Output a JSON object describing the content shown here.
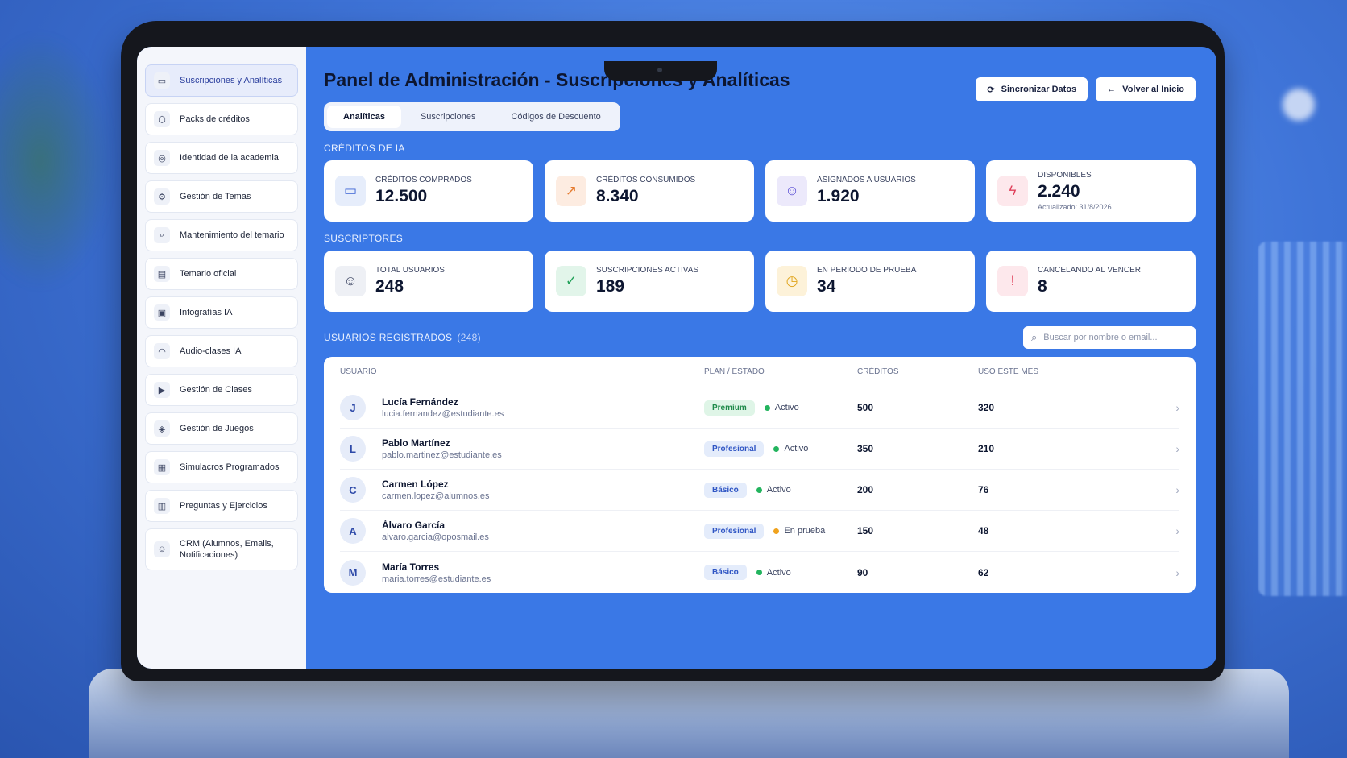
{
  "sidebar": {
    "items": [
      {
        "label": "Suscripciones y Analíticas",
        "icon": "credit-card-icon",
        "glyph": "▭",
        "active": true
      },
      {
        "label": "Packs de créditos",
        "icon": "box-icon",
        "glyph": "⬡"
      },
      {
        "label": "Identidad de la academia",
        "icon": "palette-icon",
        "glyph": "◎"
      },
      {
        "label": "Gestión de Temas",
        "icon": "gear-icon",
        "glyph": "⚙"
      },
      {
        "label": "Mantenimiento del temario",
        "icon": "search-icon",
        "glyph": "⌕"
      },
      {
        "label": "Temario oficial",
        "icon": "document-icon",
        "glyph": "▤"
      },
      {
        "label": "Infografías IA",
        "icon": "image-icon",
        "glyph": "▣"
      },
      {
        "label": "Audio-clases IA",
        "icon": "headphones-icon",
        "glyph": "◠"
      },
      {
        "label": "Gestión de Clases",
        "icon": "video-icon",
        "glyph": "▶"
      },
      {
        "label": "Gestión de Juegos",
        "icon": "gamepad-icon",
        "glyph": "◈"
      },
      {
        "label": "Simulacros Programados",
        "icon": "calendar-icon",
        "glyph": "▦"
      },
      {
        "label": "Preguntas y Ejercicios",
        "icon": "book-icon",
        "glyph": "▥"
      },
      {
        "label": "CRM (Alumnos, Emails, Notificaciones)",
        "icon": "users-icon",
        "glyph": "☺"
      }
    ]
  },
  "header": {
    "title": "Panel de Administración - Suscripciones y Analíticas",
    "sync_label": "Sincronizar Datos",
    "back_label": "Volver al Inicio"
  },
  "tabs": [
    {
      "label": "Analíticas",
      "active": true
    },
    {
      "label": "Suscripciones"
    },
    {
      "label": "Códigos de Descuento"
    }
  ],
  "credits": {
    "section_label": "CRÉDITOS DE IA",
    "cards": [
      {
        "label": "CRÉDITOS COMPRADOS",
        "value": "12.500",
        "icon": "credit-card-icon",
        "glyph": "▭",
        "tone": "blue"
      },
      {
        "label": "CRÉDITOS CONSUMIDOS",
        "value": "8.340",
        "icon": "trending-up-icon",
        "glyph": "↗",
        "tone": "orange"
      },
      {
        "label": "ASIGNADOS A USUARIOS",
        "value": "1.920",
        "icon": "users-icon",
        "glyph": "☺",
        "tone": "purple"
      },
      {
        "label": "DISPONIBLES",
        "value": "2.240",
        "note": "Actualizado: 31/8/2026",
        "icon": "lightning-icon",
        "glyph": "ϟ",
        "tone": "red"
      }
    ]
  },
  "subscribers": {
    "section_label": "SUSCRIPTORES",
    "cards": [
      {
        "label": "TOTAL USUARIOS",
        "value": "248",
        "icon": "users-icon",
        "glyph": "☺",
        "tone": "gray"
      },
      {
        "label": "SUSCRIPCIONES ACTIVAS",
        "value": "189",
        "icon": "check-shield-icon",
        "glyph": "✓",
        "tone": "green"
      },
      {
        "label": "EN PERIODO DE PRUEBA",
        "value": "34",
        "icon": "clock-icon",
        "glyph": "◷",
        "tone": "yellow"
      },
      {
        "label": "CANCELANDO AL VENCER",
        "value": "8",
        "icon": "alert-icon",
        "glyph": "!",
        "tone": "red"
      }
    ]
  },
  "users": {
    "section_label": "USUARIOS REGISTRADOS",
    "count": "(248)",
    "search_placeholder": "Buscar por nombre o email...",
    "columns": [
      "USUARIO",
      "PLAN / ESTADO",
      "CRÉDITOS",
      "USO ESTE MES"
    ],
    "rows": [
      {
        "initial": "J",
        "name": "Lucía Fernández",
        "email": "lucia.fernandez@estudiante.es",
        "plan": "Premium",
        "plan_tone": "premium",
        "status": "Activo",
        "status_tone": "green",
        "credits": "500",
        "usage": "320"
      },
      {
        "initial": "L",
        "name": "Pablo Martínez",
        "email": "pablo.martinez@estudiante.es",
        "plan": "Profesional",
        "plan_tone": "profesional",
        "status": "Activo",
        "status_tone": "green",
        "credits": "350",
        "usage": "210"
      },
      {
        "initial": "C",
        "name": "Carmen López",
        "email": "carmen.lopez@alumnos.es",
        "plan": "Básico",
        "plan_tone": "basico",
        "status": "Activo",
        "status_tone": "green",
        "credits": "200",
        "usage": "76"
      },
      {
        "initial": "A",
        "name": "Álvaro García",
        "email": "alvaro.garcia@oposmail.es",
        "plan": "Profesional",
        "plan_tone": "profesional",
        "status": "En prueba",
        "status_tone": "orange",
        "credits": "150",
        "usage": "48"
      },
      {
        "initial": "M",
        "name": "María Torres",
        "email": "maria.torres@estudiante.es",
        "plan": "Básico",
        "plan_tone": "basico",
        "status": "Activo",
        "status_tone": "green",
        "credits": "90",
        "usage": "62"
      }
    ]
  }
}
